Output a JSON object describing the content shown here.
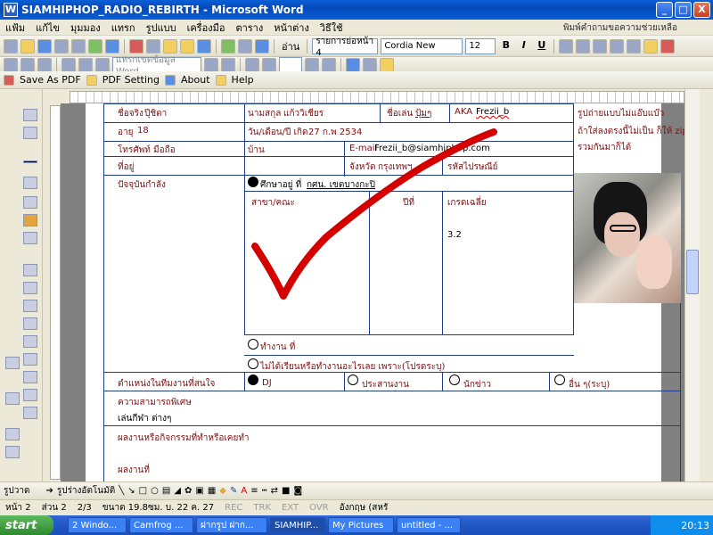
{
  "window": {
    "title": "SIAMHIPHOP_RADIO_REBIRTH - Microsoft Word",
    "minimize": "_",
    "maximize": "□",
    "close": "X"
  },
  "menu": {
    "items": [
      "แฟ้ม",
      "แก้ไข",
      "มุมมอง",
      "แทรก",
      "รูปแบบ",
      "เครื่องมือ",
      "ตาราง",
      "หน้าต่าง",
      "วิธีใช้"
    ],
    "help_prompt": "พิมพ์คำถามขอความช่วยเหลือ"
  },
  "toolbar1": {
    "read_label": "อ่าน",
    "style_value": "รายการย่อหน้า 4",
    "font_value": "Cordia New",
    "size_value": "12",
    "bold": "B",
    "italic": "I",
    "underline": "U"
  },
  "toolbar2": {
    "field_placeholder": "แทรกเขตข้อมูล Word"
  },
  "toolbar3": {
    "save_pdf": "Save As PDF",
    "pdf_setting": "PDF Setting",
    "about": "About",
    "help": "Help"
  },
  "form": {
    "real_name_label": "ชื่อจริง",
    "real_name_value": "ปุ๊ชิตา",
    "surname_label": "นามสกุล",
    "surname_value": "แก้ววิเชียร",
    "nickname_label": "ชื่อเล่น",
    "nickname_value": "ปุ้มๆ",
    "aka_label": "AKA",
    "aka_value": "Frezii_b",
    "age_label": "อายุ",
    "age_value": "18",
    "dob_label": "วัน/เดือน/ปี เกิด",
    "dob_value": "27 ก.พ 2534",
    "phone_label": "โทรศัพท์ มือถือ",
    "home_label": "บ้าน",
    "email_label": "E-mail",
    "email_value": "Frezii_b@siamhiphop.com",
    "address_label": "ที่อยู่",
    "province_label": "จังหวัด",
    "province_value": "กรุงเทพฯ",
    "postcode_label": "รหัสไปรษณีย์",
    "photo_note_1": "รูปถ่ายแบบไม่แอ๊บแบ๊ว",
    "photo_note_2": "ถ้าใส่ลงตรงนี้ไม่เป็น ก็ให้ zip",
    "photo_note_3": "รวมกันมาก็ได้",
    "current_label": "ปัจจุบันกำลัง",
    "studying_option": "ศึกษาอยู่ ที่",
    "studying_value": "กศน. เขตบางกะปิ",
    "major_label": "สาขา/คณะ",
    "year_label": "ปีที่",
    "gpa_label": "เกรดเฉลี่ย",
    "gpa_value": "3.2",
    "working_option": "ทำงาน ที่",
    "neither_option": "ไม่ได้เรียนหรือทำงานอะไรเลย เพราะ(โปรดระบุ)",
    "position_label": "ตำแหน่งในทีมงานที่สนใจ",
    "pos_dj": "DJ",
    "pos_coordinator": "ประสานงาน",
    "pos_reporter": "นักข่าว",
    "pos_other": "อื่น ๆ(ระบุ)",
    "skill_label": "ความสามารถพิเศษ",
    "skill_value": "เล่นกีฬา ต่างๆ",
    "works_label": "ผลงานหรือกิจกรรมที่ทำหรือเคยทำ",
    "partial_label": "ผลงานที่"
  },
  "drawbar": {
    "draw_label": "รูปวาด",
    "autoshape_label": "รูปร่างอัตโนมัติ"
  },
  "status": {
    "page": "หน้า 2",
    "section": "ส่วน 2",
    "pages": "2/3",
    "position": "ขนาด 19.8ซม. บ. 22 ค. 27",
    "rec": "REC",
    "trk": "TRK",
    "ext": "EXT",
    "ovr": "OVR",
    "language": "อังกฤษ (สหรั"
  },
  "taskbar": {
    "start": "start",
    "buttons": [
      "2 Windo...",
      "Camfrog ...",
      "ฝากรูป ฝาก...",
      "SIAMHIP...",
      "My Pictures",
      "untitled - ..."
    ],
    "clock": "20:13"
  },
  "colors": {
    "title_blue": "#0a5fd8",
    "label_red": "#7a1010",
    "table_border": "#1f3d8c",
    "check_red": "#d40000"
  }
}
